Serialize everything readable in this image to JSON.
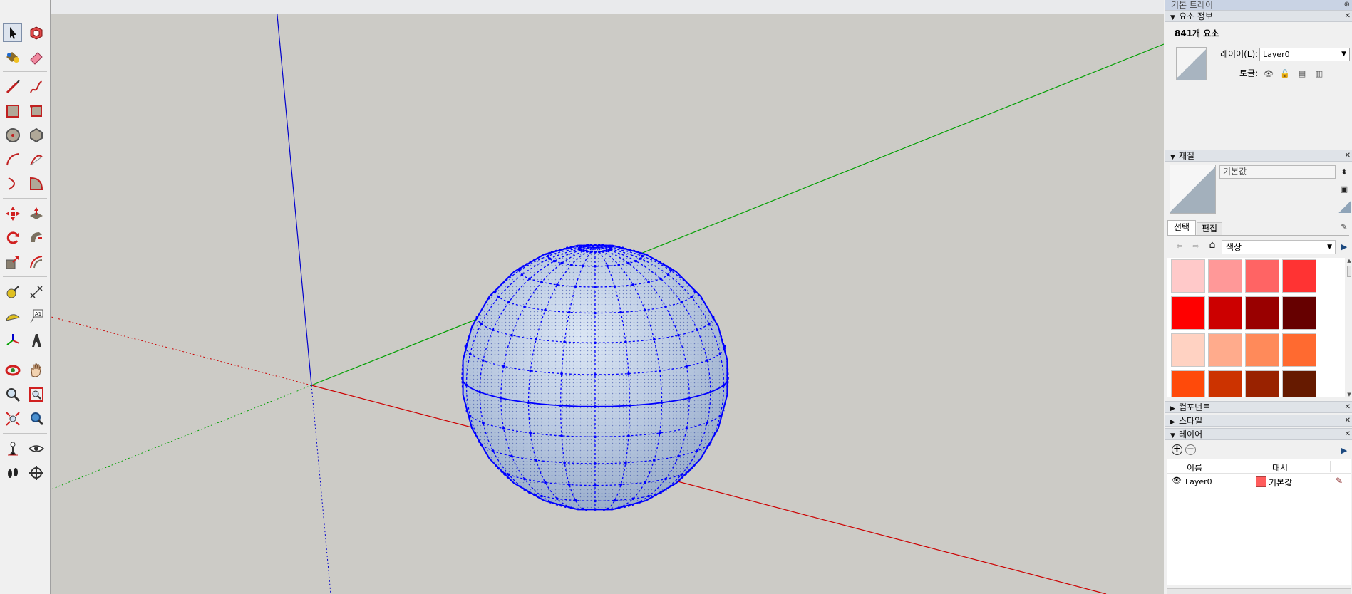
{
  "tray": {
    "title": "기본 트레이",
    "entity_info": {
      "header": "요소 정보",
      "count": "841개 요소",
      "layer_label": "레이어(L):",
      "layer_value": "Layer0",
      "toggle_label": "토글:"
    },
    "materials": {
      "header": "재질",
      "name": "기본값",
      "tab_select": "선택",
      "tab_edit": "편집",
      "library": "색상",
      "swatches": [
        "#ffc9c9",
        "#ff9898",
        "#ff6464",
        "#ff3333",
        "#ff0000",
        "#cc0000",
        "#990000",
        "#660000",
        "#ffd2c2",
        "#ffab8c",
        "#ff8a5a",
        "#ff6a30",
        "#ff4a0a",
        "#cc3300",
        "#992200",
        "#661a00"
      ]
    },
    "components": {
      "header": "컴포넌트"
    },
    "styles": {
      "header": "스타일"
    },
    "layers": {
      "header": "레이어",
      "col_name": "이름",
      "col_dash": "대시",
      "rows": [
        {
          "name": "Layer0",
          "material": "기본값",
          "color": "#ff5c5c"
        }
      ]
    }
  },
  "colors": {
    "viewport_bg": "#cccbc6",
    "axis_red": "#cc0000",
    "axis_green": "#00a000",
    "axis_blue": "#0000cc",
    "selection": "#0000ff",
    "sphere_fill": "#aebfd8"
  }
}
